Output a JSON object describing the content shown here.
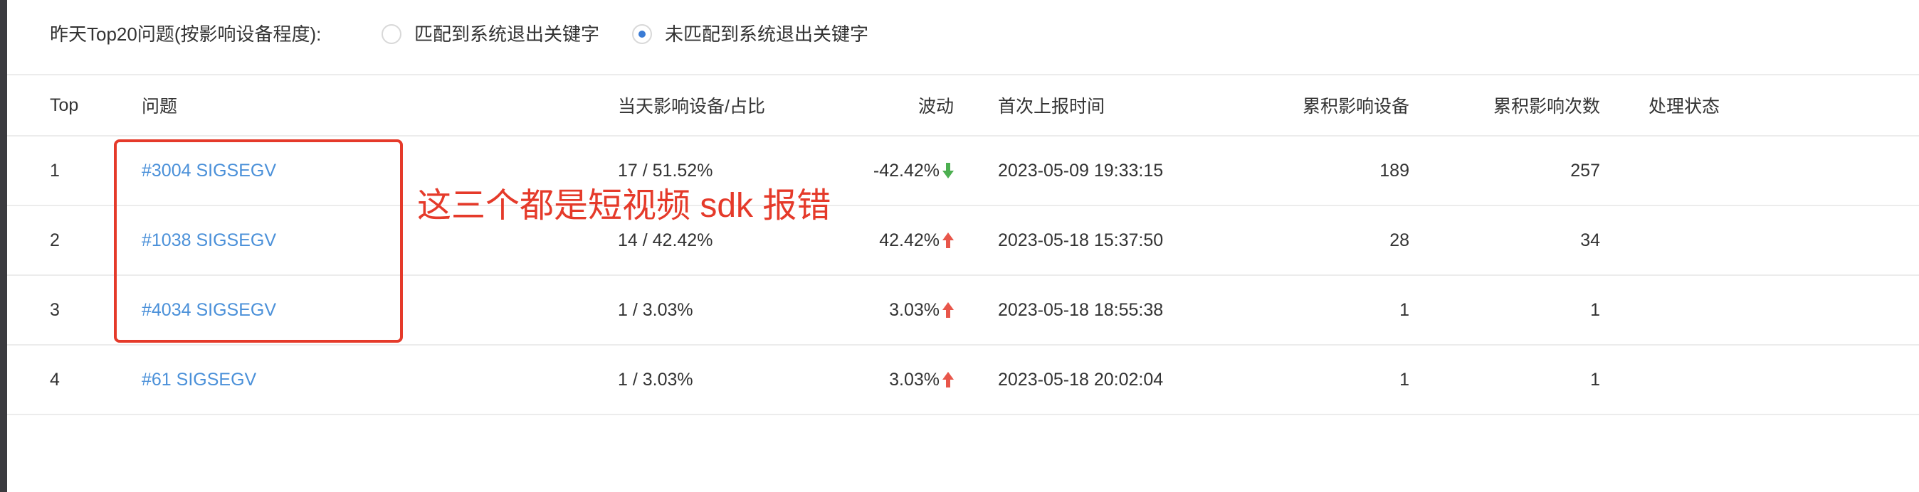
{
  "filter": {
    "label": "昨天Top20问题(按影响设备程度):",
    "options": [
      {
        "label": "匹配到系统退出关键字",
        "checked": false
      },
      {
        "label": "未匹配到系统退出关键字",
        "checked": true
      }
    ]
  },
  "table": {
    "columns": {
      "top": "Top",
      "issue": "问题",
      "ratio": "当天影响设备/占比",
      "wave": "波动",
      "first": "首次上报时间",
      "devices": "累积影响设备",
      "count": "累积影响次数",
      "status": "处理状态"
    },
    "rows": [
      {
        "top": "1",
        "issue": "#3004 SIGSEGV",
        "ratio": "17 / 51.52%",
        "wave": "-42.42%",
        "trend": "down",
        "first": "2023-05-09 19:33:15",
        "devices": "189",
        "count": "257",
        "status": ""
      },
      {
        "top": "2",
        "issue": "#1038 SIGSEGV",
        "ratio": "14 / 42.42%",
        "wave": "42.42%",
        "trend": "up",
        "first": "2023-05-18 15:37:50",
        "devices": "28",
        "count": "34",
        "status": ""
      },
      {
        "top": "3",
        "issue": "#4034 SIGSEGV",
        "ratio": "1 / 3.03%",
        "wave": "3.03%",
        "trend": "up",
        "first": "2023-05-18 18:55:38",
        "devices": "1",
        "count": "1",
        "status": ""
      },
      {
        "top": "4",
        "issue": "#61 SIGSEGV",
        "ratio": "1 / 3.03%",
        "wave": "3.03%",
        "trend": "up",
        "first": "2023-05-18 20:02:04",
        "devices": "1",
        "count": "1",
        "status": ""
      }
    ]
  },
  "annotation": {
    "text": "这三个都是短视频 sdk 报错"
  },
  "colors": {
    "up": "#e8564a",
    "down": "#4caf50",
    "link": "#4a90d9",
    "annotation": "#e53a2a"
  }
}
